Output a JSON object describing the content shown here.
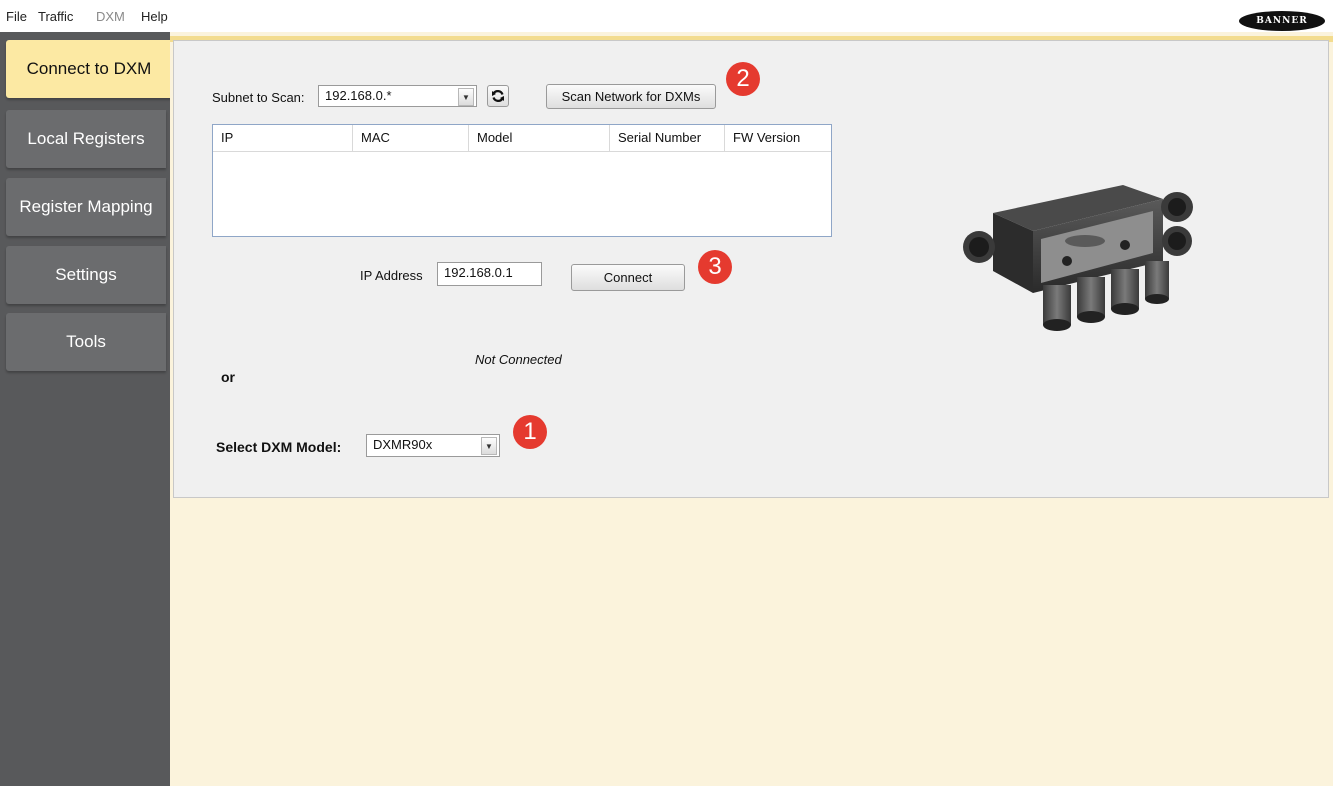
{
  "menu": {
    "file": "File",
    "traffic": "Traffic",
    "dxm": "DXM",
    "help": "Help"
  },
  "brand": {
    "logo_text": "BANNER"
  },
  "nav": {
    "connect": "Connect to DXM",
    "local_registers": "Local Registers",
    "register_mapping": "Register Mapping",
    "settings": "Settings",
    "tools": "Tools"
  },
  "scan": {
    "subnet_label": "Subnet to Scan:",
    "subnet_value": "192.168.0.*",
    "scan_button": "Scan Network for DXMs"
  },
  "results_table": {
    "columns": [
      "IP",
      "MAC",
      "Model",
      "Serial Number",
      "FW Version"
    ],
    "rows": []
  },
  "connection": {
    "ip_label": "IP Address",
    "ip_value": "192.168.0.1",
    "connect_button": "Connect",
    "status": "Not Connected"
  },
  "or_text": "or",
  "model_select": {
    "label": "Select DXM Model:",
    "value": "DXMR90x"
  },
  "callouts": {
    "one": "1",
    "two": "2",
    "three": "3"
  },
  "colors": {
    "sidebar": "#58595b",
    "active_tab": "#fce9a3",
    "accent": "#f3dc8e",
    "callout": "#e53a2f"
  },
  "icons": {
    "refresh": "refresh-icon",
    "dropdown": "chevron-down-icon",
    "device": "device-image"
  }
}
